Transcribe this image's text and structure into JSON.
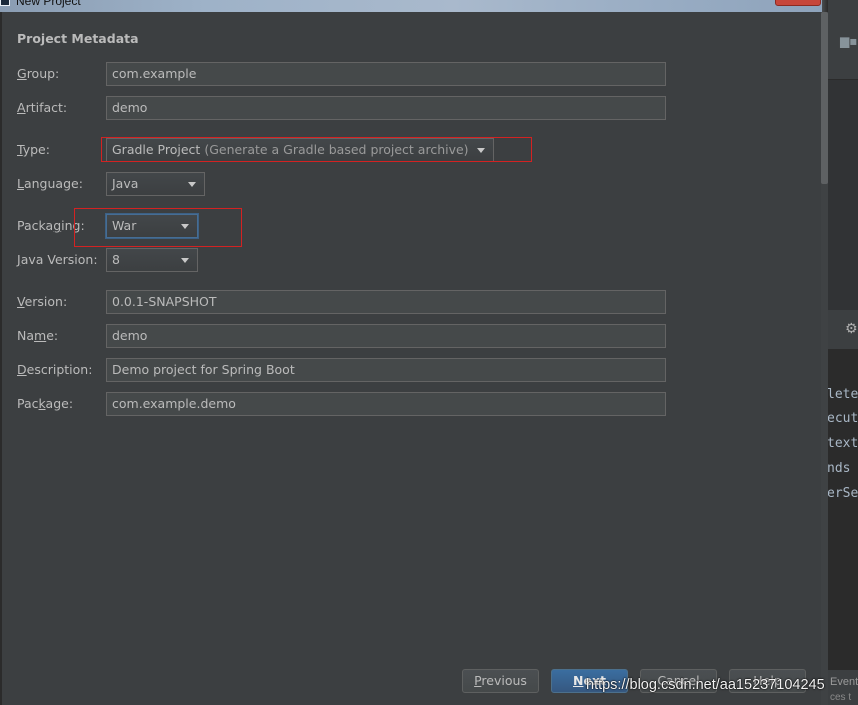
{
  "window": {
    "title": "New Project"
  },
  "section_title": "Project Metadata",
  "fields": {
    "group": {
      "label_pre": "",
      "label_mn": "G",
      "label_post": "roup:",
      "value": "com.example"
    },
    "artifact": {
      "label_pre": "",
      "label_mn": "A",
      "label_post": "rtifact:",
      "value": "demo"
    },
    "version": {
      "label_pre": "",
      "label_mn": "V",
      "label_post": "ersion:",
      "value": "0.0.1-SNAPSHOT"
    },
    "name": {
      "label_pre": "Na",
      "label_mn": "m",
      "label_post": "e:",
      "value": "demo"
    },
    "description": {
      "label_pre": "",
      "label_mn": "D",
      "label_post": "escription:",
      "value": "Demo project for Spring Boot"
    },
    "package": {
      "label_pre": "Pac",
      "label_mn": "k",
      "label_post": "age:",
      "value": "com.example.demo"
    }
  },
  "combos": {
    "type": {
      "label_pre": "",
      "label_mn": "T",
      "label_post": "ype:",
      "value": "Gradle Project",
      "description": "(Generate a Gradle based project archive)"
    },
    "language": {
      "label_pre": "",
      "label_mn": "L",
      "label_post": "anguage:",
      "value": "Java"
    },
    "packaging": {
      "label_pre": "Packa",
      "label_mn": "g",
      "label_post": "ing:",
      "value": "War"
    },
    "java_version": {
      "label_pre": "",
      "label_mn": "J",
      "label_post": "ava Version:",
      "value": "8"
    }
  },
  "buttons": {
    "previous": {
      "mn": "P",
      "rest": "revious"
    },
    "next": {
      "mn": "N",
      "rest": "ext"
    },
    "cancel": {
      "label": "Cancel"
    },
    "help": {
      "label": "Help"
    }
  },
  "watermark": "https://blog.csdn.net/aa15237104245",
  "background_ide": {
    "console_lines": [
      "lete",
      "ecut",
      "text",
      "nds",
      "erSe"
    ],
    "bottom_text": "Event",
    "bottom_text2": "ces t"
  },
  "colors": {
    "dialog_background": "#3c3f41",
    "field_background": "#45494a",
    "primary_button": "#365880",
    "highlight_box": "#d32222"
  }
}
